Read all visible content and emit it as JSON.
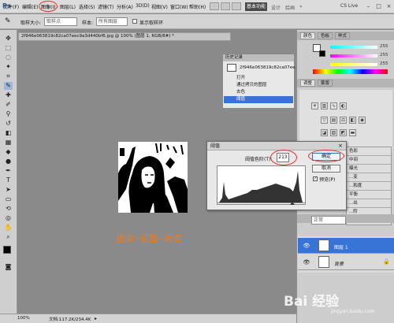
{
  "app": {
    "logo": "Ps"
  },
  "menubar": {
    "items": [
      "文件(F)",
      "编辑(E)",
      "图像(I)",
      "图层(L)",
      "选择(S)",
      "滤镜(T)",
      "分析(A)",
      "3D(D)",
      "视图(V)",
      "窗口(W)",
      "帮助(H)"
    ],
    "active_item": "图像(I)",
    "workspace_button": "基本功能",
    "workspace_links": [
      "设计",
      "绘画",
      "»"
    ],
    "cs_live": "CS Live",
    "window_buttons": [
      "–",
      "□",
      "×"
    ]
  },
  "options_bar": {
    "sample_size_label": "取样大小:",
    "sample_size_value": "取样点",
    "sample_label": "样本:",
    "sample_value": "所有图层",
    "show_ring_label": "显示取样环"
  },
  "document": {
    "tab_title": "2f946e063819c82ca07eec9a3d440bf6.jpg @ 100% (图层 1, RGB/8#) *",
    "zoom": "100%",
    "doc_info": "文档:117.2K/234.4K"
  },
  "history_panel": {
    "title": "历史记录",
    "snapshot": "2f946e063819c82ca07ee...",
    "items": [
      "打开",
      "通过拷贝的图层",
      "去色",
      "阈值"
    ],
    "selected": "阈值"
  },
  "color_panel": {
    "tabs": [
      "颜色",
      "色板",
      "样式"
    ],
    "values": [
      "255",
      "255",
      "255"
    ],
    "slider_colors": [
      "#ff4040",
      "#40ff40",
      "#4040ff"
    ]
  },
  "adjust_panel": {
    "tabs": [
      "调整",
      "蒙版"
    ],
    "rows": [
      "色彩",
      "中间",
      "曝光",
      "...变",
      "...和度",
      "平衡",
      "...出",
      "...阶"
    ]
  },
  "threshold_dialog": {
    "title": "阈值",
    "level_label": "阈值色阶(T):",
    "level_value": "213",
    "ok": "确定",
    "cancel": "取消",
    "preview_label": "预览(P)",
    "preview_checked": "✓",
    "close": "×"
  },
  "layers_panel": {
    "mode": "正常",
    "layers": [
      "图层 1",
      "背景"
    ],
    "selected": "图层 1"
  },
  "caption": "图像--调整--阈值",
  "watermark": {
    "brand": "Bai 经验",
    "url": "jingyan.baidu.com"
  }
}
